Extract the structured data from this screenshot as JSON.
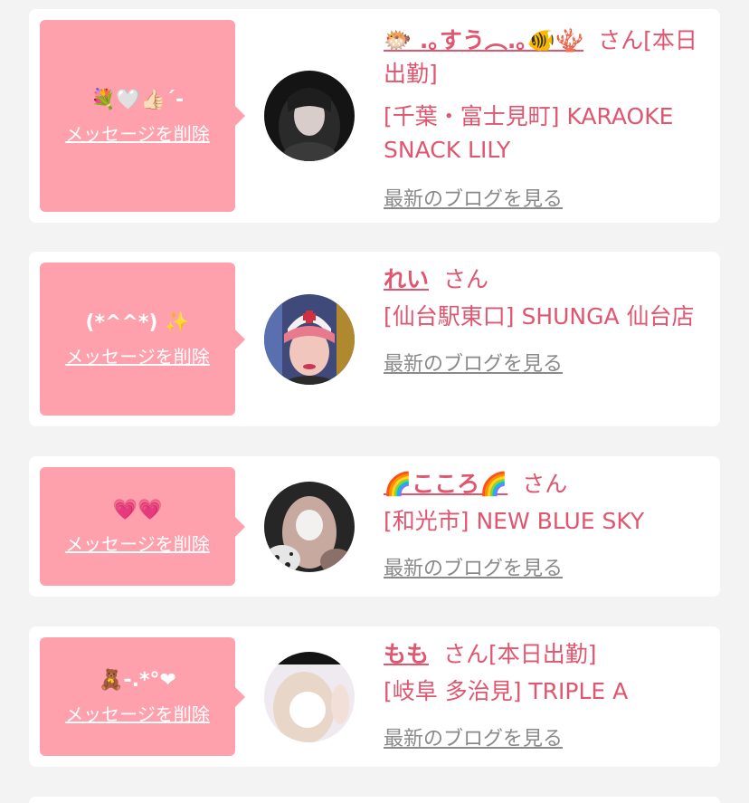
{
  "cards": [
    {
      "message": "💐🤍👍🏻´-",
      "delete_label": "メッセージを削除",
      "name": "🐡 .｡すう︵.｡🐠🪸",
      "suffix": "さん[本日出勤]",
      "shop": "[千葉・富士見町] KARAOKE SNACK LILY",
      "blog_label": "最新のブログを見る"
    },
    {
      "message": "(*^^*) ✨",
      "delete_label": "メッセージを削除",
      "name": "れい",
      "suffix": "さん",
      "shop": "[仙台駅東口] SHUNGA 仙台店",
      "blog_label": "最新のブログを見る"
    },
    {
      "message": "💗💗",
      "delete_label": "メッセージを削除",
      "name": "🌈こころ🌈",
      "suffix": "さん",
      "shop": "[和光市] NEW BLUE SKY",
      "blog_label": "最新のブログを見る"
    },
    {
      "message": "🧸-.*°❤",
      "delete_label": "メッセージを削除",
      "name": "もも",
      "suffix": "さん[本日出勤]",
      "shop": "[岐阜 多治見] TRIPLE A",
      "blog_label": "最新のブログを見る"
    }
  ],
  "colors": {
    "bubble": "#ffa0ad",
    "accent": "#e0566f",
    "link_gray": "#8a8a8a",
    "background": "#f3f3f3"
  }
}
